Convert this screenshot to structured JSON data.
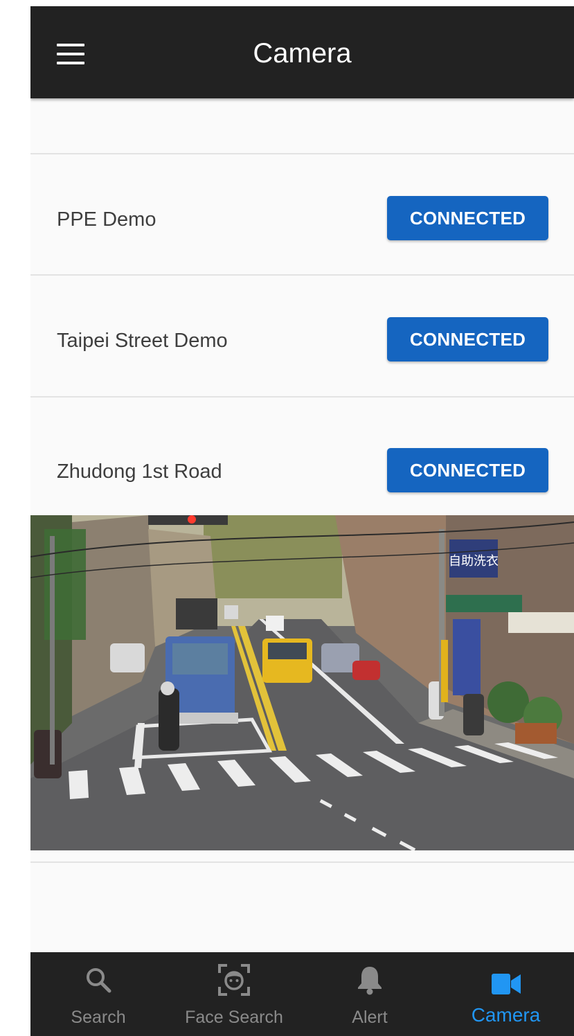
{
  "header": {
    "title": "Camera"
  },
  "cameras": [
    {
      "name": "PPE Demo",
      "status": "CONNECTED"
    },
    {
      "name": "Taipei Street Demo",
      "status": "CONNECTED"
    },
    {
      "name": "Zhudong 1st Road",
      "status": "CONNECTED"
    }
  ],
  "video": {
    "shop_sign": "自助洗衣"
  },
  "bottom_nav": [
    {
      "label": "Search",
      "icon": "search-icon"
    },
    {
      "label": "Face Search",
      "icon": "face-scan-icon"
    },
    {
      "label": "Alert",
      "icon": "bell-icon"
    },
    {
      "label": "Camera",
      "icon": "video-camera-icon",
      "active": true
    }
  ],
  "colors": {
    "bar_background": "#222222",
    "button_blue": "#1565c0",
    "active_tab": "#2196f3",
    "inactive_tab": "#8a8a8a",
    "content_background": "#fafafa"
  }
}
